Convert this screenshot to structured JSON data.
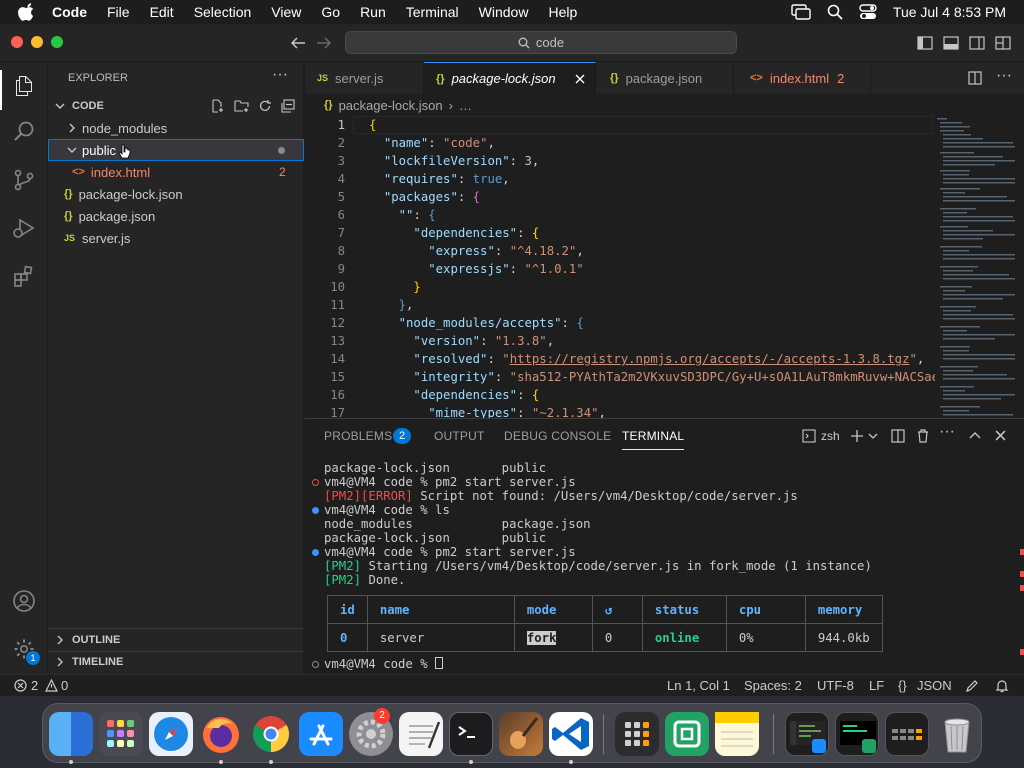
{
  "menubar": {
    "app": "Code",
    "items": [
      "File",
      "Edit",
      "Selection",
      "View",
      "Go",
      "Run",
      "Terminal",
      "Window",
      "Help"
    ],
    "datetime": "Tue Jul 4  8:53 PM"
  },
  "titlebar": {
    "search": "code"
  },
  "sidebar": {
    "title": "EXPLORER",
    "folder": "CODE",
    "tree": [
      {
        "label": "node_modules",
        "type": "folder"
      },
      {
        "label": "public",
        "type": "folder-open"
      },
      {
        "label": "index.html",
        "type": "html",
        "badge": "2"
      },
      {
        "label": "package-lock.json",
        "type": "json"
      },
      {
        "label": "package.json",
        "type": "json"
      },
      {
        "label": "server.js",
        "type": "js"
      }
    ],
    "outline": "OUTLINE",
    "timeline": "TIMELINE"
  },
  "tabs": [
    {
      "label": "server.js",
      "icon": "JS"
    },
    {
      "label": "package-lock.json",
      "icon": "{}"
    },
    {
      "label": "package.json",
      "icon": "{}"
    },
    {
      "label": "index.html",
      "icon": "<>",
      "badge": "2"
    }
  ],
  "breadcrumb": {
    "file": "package-lock.json",
    "rest": "…"
  },
  "editor": {
    "line_numbers": [
      "1",
      "2",
      "3",
      "4",
      "5",
      "6",
      "7",
      "8",
      "9",
      "10",
      "11",
      "12",
      "13",
      "14",
      "15",
      "16",
      "17"
    ]
  },
  "panel": {
    "tabs": {
      "problems": "PROBLEMS",
      "problems_count": "2",
      "output": "OUTPUT",
      "debug": "DEBUG CONSOLE",
      "terminal": "TERMINAL"
    },
    "shell": "zsh",
    "terminal_lines": [
      "package-lock.json       public",
      "vm4@VM4 code % pm2 start server.js",
      "[PM2][ERROR] Script not found: /Users/vm4/Desktop/code/server.js",
      "vm4@VM4 code % ls",
      "node_modules            package.json",
      "package-lock.json       public",
      "vm4@VM4 code % pm2 start server.js",
      "Starting /Users/vm4/Desktop/code/server.js in fork_mode (1 instance)",
      "Done."
    ],
    "pm2_tag": "[PM2]",
    "pm2_error_tag": "[PM2][ERROR]",
    "pm2_table": {
      "headers": [
        "id",
        "name",
        "mode",
        "↺",
        "status",
        "cpu",
        "memory"
      ],
      "row": [
        "0",
        "server",
        "fork",
        "0",
        "online",
        "0%",
        "944.0kb"
      ]
    },
    "prompt": "vm4@VM4 code % "
  },
  "statusbar": {
    "errors": "2",
    "warnings": "0",
    "position": "Ln 1, Col 1",
    "spaces": "Spaces: 2",
    "encoding": "UTF-8",
    "eol": "LF",
    "language": "JSON"
  },
  "dock": {
    "settings_badge": "2",
    "extensions_badge": "1"
  }
}
